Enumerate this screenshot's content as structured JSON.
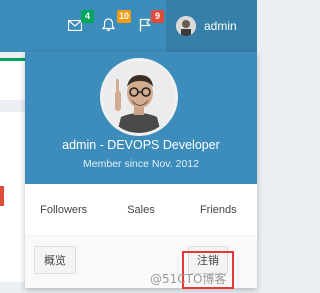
{
  "navbar": {
    "icons": [
      {
        "name": "envelope-icon",
        "badge": "4",
        "badge_color": "#00a65a"
      },
      {
        "name": "bell-icon",
        "badge": "10",
        "badge_color": "#f39c12"
      },
      {
        "name": "flag-icon",
        "badge": "9",
        "badge_color": "#dd4b39"
      }
    ],
    "username": "admin"
  },
  "profile": {
    "title": "admin - DEVOPS Developer",
    "member_since": "Member since Nov. 2012"
  },
  "links": [
    "Followers",
    "Sales",
    "Friends"
  ],
  "footer": {
    "profile_label": "概览",
    "signout_label": "注销"
  },
  "watermark": "@51CTO博客",
  "colors": {
    "header_blue": "#3c8dbc",
    "user_menu_blue": "#367fa9",
    "highlight_red": "#e53935"
  }
}
